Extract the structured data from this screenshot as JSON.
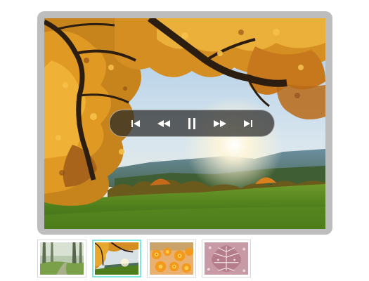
{
  "gallery": {
    "active_index": 0,
    "controls": {
      "first": "skip-to-first-icon",
      "prev": "rewind-icon",
      "pause": "pause-icon",
      "next": "fast-forward-icon",
      "last": "skip-to-last-icon"
    },
    "thumbnails": [
      {
        "id": "forest-path",
        "active": false
      },
      {
        "id": "autumn-tree",
        "active": true
      },
      {
        "id": "orange-flowers",
        "active": false
      },
      {
        "id": "frosted-leaf",
        "active": false
      }
    ]
  },
  "colors": {
    "frame": "#bdbdbd",
    "active_thumb_border": "#7fe6e1",
    "control_bar": "#282828"
  }
}
